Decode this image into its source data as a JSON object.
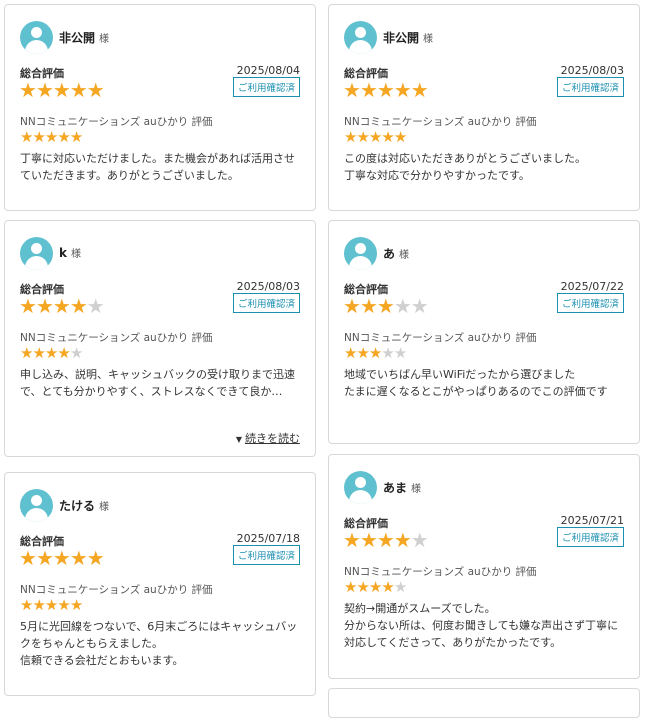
{
  "labels": {
    "honorific": "様",
    "overall": "総合評価",
    "confirmed_badge": "ご利用確認済",
    "service_rating": "NNコミュニケーションズ auひかり 評価",
    "read_more": "続きを読む"
  },
  "colors": {
    "star_on": "#f5a623",
    "star_off": "#d0d0d0",
    "accent": "#1a8fb0",
    "avatar": "#5fc0d0"
  },
  "reviews": [
    {
      "name": "非公開",
      "date": "2025/08/04",
      "overall_rating": 5,
      "service_rating": 5,
      "comment": "丁寧に対応いただけました。また機会があれば活用させていただきます。ありがとうございました。"
    },
    {
      "name": "非公開",
      "date": "2025/08/03",
      "overall_rating": 5,
      "service_rating": 5,
      "comment": "この度は対応いただきありがとうございました。\n丁寧な対応で分かりやすかったです。"
    },
    {
      "name": "k",
      "date": "2025/08/03",
      "overall_rating": 4,
      "service_rating": 4,
      "comment": "申し込み、説明、キャッシュバックの受け取りまで迅速で、とても分かりやすく、ストレスなくできて良か…"
    },
    {
      "name": "あ",
      "date": "2025/07/22",
      "overall_rating": 3,
      "service_rating": 3,
      "comment": "地域でいちばん早いWiFiだったから選びました\nたまに遅くなるとこがやっぱりあるのでこの評価です"
    },
    {
      "name": "たける",
      "date": "2025/07/18",
      "overall_rating": 5,
      "service_rating": 5,
      "comment": "5月に光回線をつないで、6月末ごろにはキャッシュバックをちゃんともらえました。\n信頼できる会社だとおもいます。"
    },
    {
      "name": "あま",
      "date": "2025/07/21",
      "overall_rating": 4,
      "service_rating": 4,
      "comment": "契約→開通がスムーズでした。\n分からない所は、何度お聞きしても嫌な声出さず丁寧に対応してくださって、ありがたかったです。"
    }
  ]
}
